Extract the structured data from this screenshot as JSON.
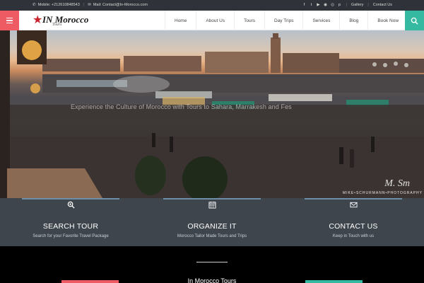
{
  "topbar": {
    "mobile": "Mobile: +212610848543",
    "mail": "Mail: Contact@In-Morocco.com",
    "social_icons": [
      "facebook-icon",
      "twitter-icon",
      "youtube-icon",
      "instagram-icon",
      "tripadvisor-icon",
      "pinterest-icon"
    ],
    "gallery": "Gallery",
    "contact": "Contact Us"
  },
  "header": {
    "logo": {
      "brand": "IN Morocco",
      "sub": "Tours"
    },
    "nav": [
      "Home",
      "About Us",
      "Tours",
      "Day Trips",
      "Services",
      "Blog",
      "Book Now"
    ]
  },
  "hero": {
    "tagline": "Experience the Culture of Morocco with Tours to Sahara, Marrakesh and Fes",
    "signature": "M. Sm",
    "credit": "MIKE•SCHURMANN•PHOTOGRAPHY"
  },
  "features": [
    {
      "icon": "search-icon",
      "title": "SEARCH TOUR",
      "desc": "Search for your Favorite Travel Package"
    },
    {
      "icon": "calendar-icon",
      "title": "ORGANIZE IT",
      "desc": "Morocco Tailor Made Tours and Trips"
    },
    {
      "icon": "envelope-icon",
      "title": "CONTACT US",
      "desc": "Keep in Touch with us"
    }
  ],
  "bottom": {
    "heading": "In Morocco Tours"
  },
  "colors": {
    "accent_red": "#ef5b62",
    "accent_teal": "#35b9a0",
    "feature_bg": "#3e454d"
  }
}
